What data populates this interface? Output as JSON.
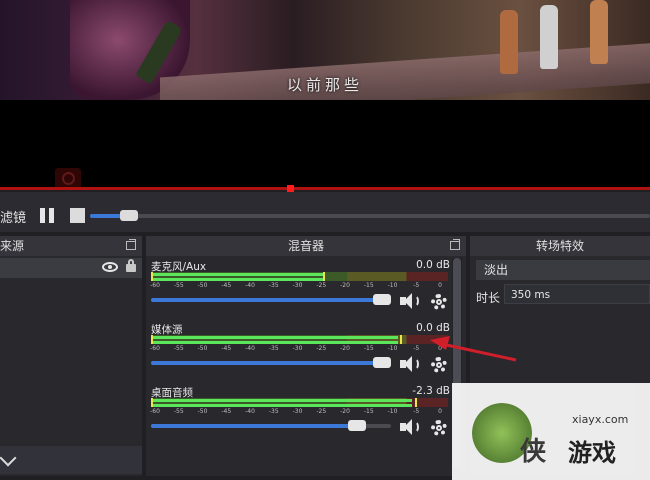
{
  "preview": {
    "subtitle": "以前那些"
  },
  "controls": {
    "filters_label": "滤镜",
    "media_progress": 0.07
  },
  "sources": {
    "title": "来源"
  },
  "mixer": {
    "title": "混音器",
    "ticks": [
      "-60",
      "-55",
      "-50",
      "-45",
      "-40",
      "-35",
      "-30",
      "-25",
      "-20",
      "-15",
      "-10",
      "-5",
      "0"
    ],
    "channels": [
      {
        "name": "麦克风/Aux",
        "db": "0.0 dB",
        "level": 0.58,
        "peak": 0.58,
        "volume": 1.0
      },
      {
        "name": "媒体源",
        "db": "0.0 dB",
        "level": 0.83,
        "peak": 0.84,
        "volume": 1.0
      },
      {
        "name": "桌面音频",
        "db": "-2.3 dB",
        "level": 0.88,
        "peak": 0.89,
        "volume": 0.86
      }
    ]
  },
  "transitions": {
    "title": "转场特效",
    "selected": "淡出",
    "duration_label": "时长",
    "duration_value": "350 ms"
  },
  "watermark": {
    "site": "xiayx.com",
    "text": "游戏",
    "sub": "侠"
  },
  "colors": {
    "accent": "#3b78d8",
    "seekbar": "#b01212",
    "meter_green": "#5ce65c",
    "annotation": "#d01e2a"
  }
}
